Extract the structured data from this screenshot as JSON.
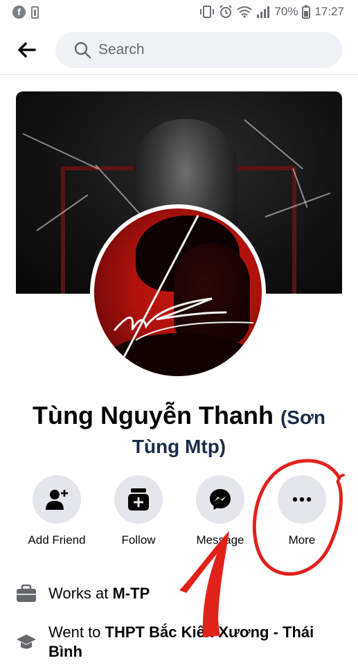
{
  "status_bar": {
    "battery_percent": "70%",
    "time": "17:27"
  },
  "search": {
    "placeholder": "Search"
  },
  "profile": {
    "name": "Tùng Nguyễn Thanh",
    "alternate_name_part1": "(Sơn",
    "alternate_name_part2": "Tùng Mtp)"
  },
  "actions": [
    {
      "label": "Add Friend",
      "icon": "add-friend-icon"
    },
    {
      "label": "Follow",
      "icon": "follow-icon"
    },
    {
      "label": "Message",
      "icon": "messenger-icon"
    },
    {
      "label": "More",
      "icon": "more-icon"
    }
  ],
  "info": {
    "work_prefix": "Works at",
    "work_place": "M-TP",
    "school_prefix": "Went to",
    "school_name": "THPT Bắc Kiến Xương - Thái Bình"
  },
  "annotation": {
    "text": "1",
    "color": "#e0221b"
  },
  "colors": {
    "button_bg": "#e4e6eb",
    "search_bg": "#f0f2f5",
    "text_primary": "#050505",
    "text_secondary": "#65676b"
  }
}
